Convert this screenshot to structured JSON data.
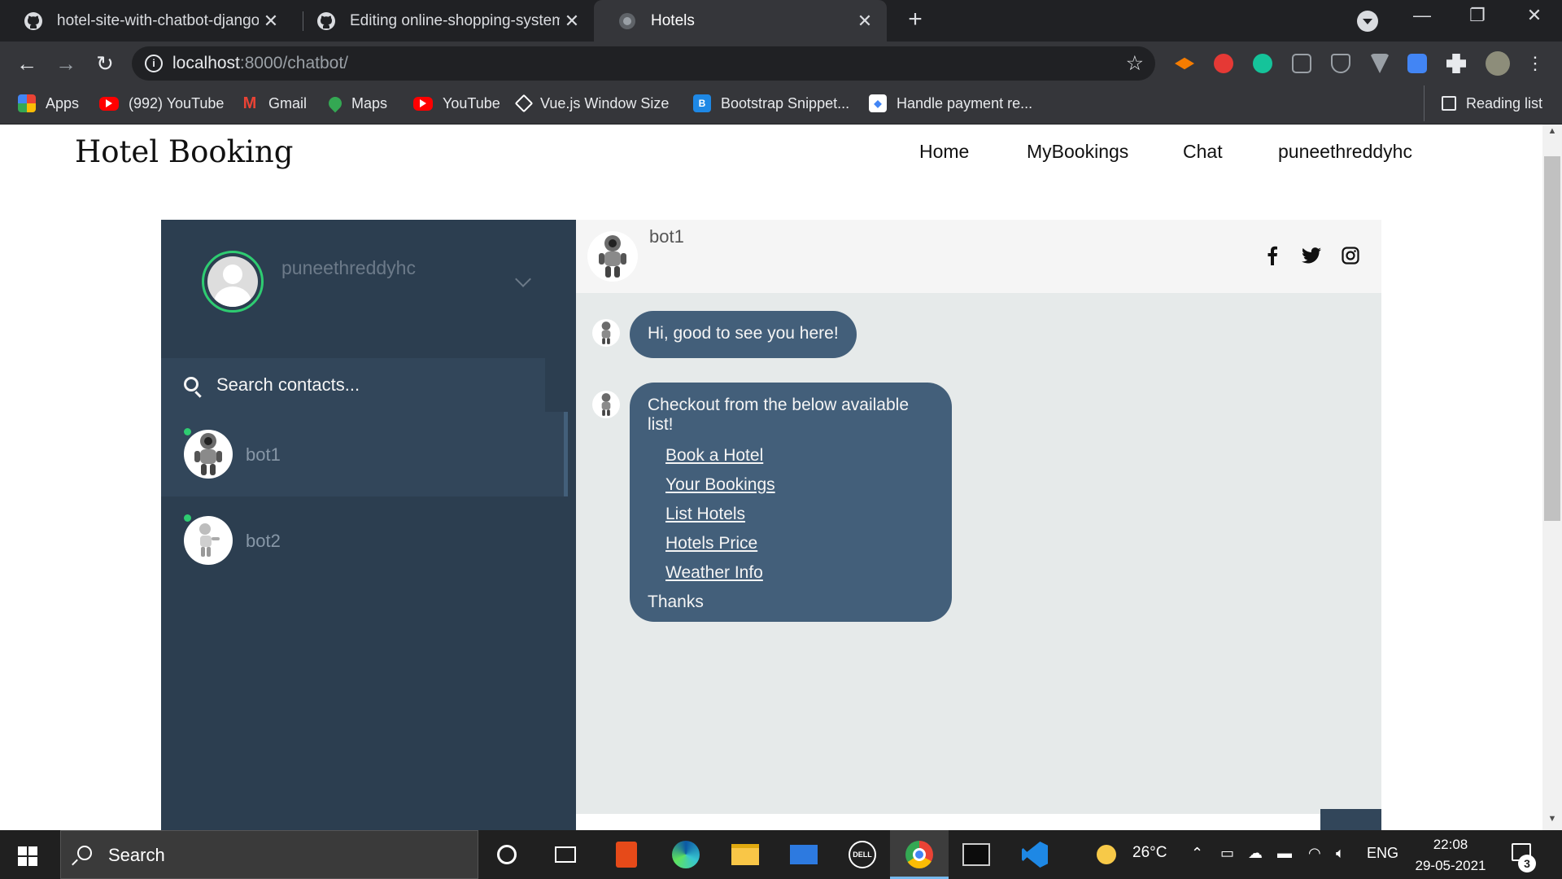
{
  "browser": {
    "tabs": [
      {
        "title": "hotel-site-with-chatbot-django-n",
        "icon": "github-icon",
        "active": false
      },
      {
        "title": "Editing online-shopping-system-",
        "icon": "github-icon",
        "active": false
      },
      {
        "title": "Hotels",
        "icon": "globe-icon",
        "active": true
      }
    ],
    "new_tab_label": "+",
    "url_host": "localhost",
    "url_rest": ":8000/chatbot/",
    "bookmarks": [
      {
        "label": "Apps",
        "icon": "apps-grid-icon"
      },
      {
        "label": "(992) YouTube",
        "icon": "youtube-icon"
      },
      {
        "label": "Gmail",
        "icon": "gmail-icon"
      },
      {
        "label": "Maps",
        "icon": "maps-icon"
      },
      {
        "label": "YouTube",
        "icon": "youtube-icon"
      },
      {
        "label": "Vue.js Window Size",
        "icon": "codepen-icon"
      },
      {
        "label": "Bootstrap Snippet...",
        "icon": "bootstrap-icon"
      },
      {
        "label": "Handle payment re...",
        "icon": "payment-icon"
      }
    ],
    "reading_list": "Reading list"
  },
  "site": {
    "brand": "Hotel Booking",
    "nav": [
      "Home",
      "MyBookings",
      "Chat",
      "puneethreddyhc"
    ]
  },
  "chat": {
    "profile_name": "puneethreddyhc",
    "search_placeholder": "Search contacts...",
    "contacts": [
      {
        "name": "bot1",
        "online": true,
        "active": true
      },
      {
        "name": "bot2",
        "online": true,
        "active": false
      }
    ],
    "header_name": "bot1",
    "social_icons": [
      "facebook-icon",
      "twitter-icon",
      "instagram-icon"
    ],
    "messages": [
      {
        "text": "Hi, good to see you here!"
      },
      {
        "intro": "Checkout from the below available list!",
        "links": [
          "Book a Hotel",
          "Your Bookings",
          "List Hotels",
          "Hotels Price",
          "Weather Info"
        ],
        "outro": "Thanks"
      }
    ]
  },
  "taskbar": {
    "search_label": "Search",
    "weather": "26°C",
    "language": "ENG",
    "time": "22:08",
    "date": "29-05-2021",
    "notifications": "3"
  },
  "colors": {
    "sidebar": "#2c3e50",
    "sidebar_active": "#32465a",
    "bubble": "#435f7a",
    "chat_bg": "#e6eaea",
    "online": "#2ecc71"
  }
}
